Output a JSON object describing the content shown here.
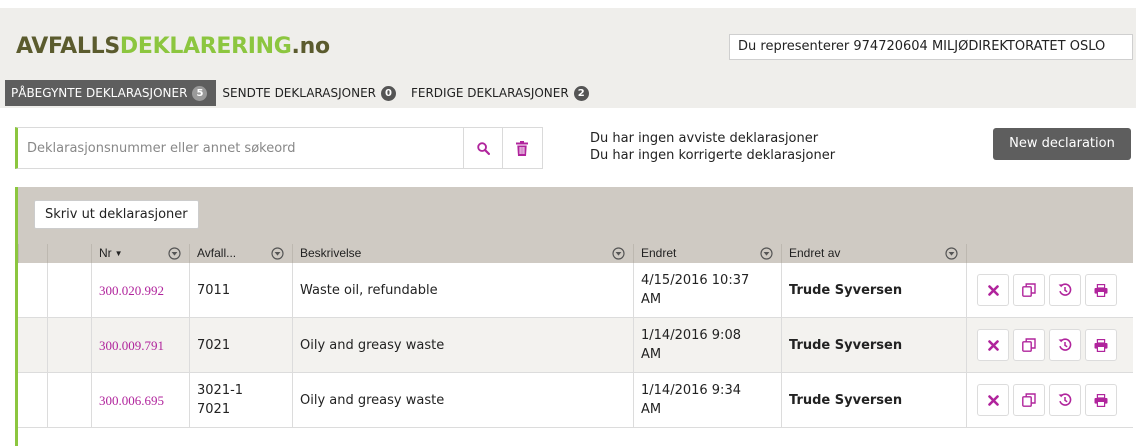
{
  "header": {
    "logo": {
      "part1": "AVFALLS",
      "part2": "DEKLARERING",
      "part3": ".no"
    },
    "representing": "Du representerer 974720604 MILJØDIREKTORATET OSLO"
  },
  "tabs": [
    {
      "label": "PÅBEGYNTE DEKLARASJONER",
      "count": "5"
    },
    {
      "label": "SENDTE DEKLARASJONER",
      "count": "0"
    },
    {
      "label": "FERDIGE DEKLARASJONER",
      "count": "2"
    }
  ],
  "search": {
    "placeholder": "Deklarasjonsnummer eller annet søkeord"
  },
  "info": {
    "line1": "Du har ingen avviste deklarasjoner",
    "line2": "Du har ingen korrigerte deklarasjoner"
  },
  "new_button": "New declaration",
  "print_button": "Skriv ut deklarasjoner",
  "table": {
    "columns": {
      "nr": "Nr",
      "avfall": "Avfall...",
      "beskrivelse": "Beskrivelse",
      "endret": "Endret",
      "endret_av": "Endret av"
    },
    "rows": [
      {
        "nr": "300.020.992",
        "avfall1": "7011",
        "avfall2": "",
        "beskrivelse": "Waste oil, refundable",
        "endret1": "4/15/2016 10:37",
        "endret2": "AM",
        "endret_av": "Trude Syversen"
      },
      {
        "nr": "300.009.791",
        "avfall1": "7021",
        "avfall2": "",
        "beskrivelse": "Oily and greasy waste",
        "endret1": "1/14/2016 9:08",
        "endret2": "AM",
        "endret_av": "Trude Syversen"
      },
      {
        "nr": "300.006.695",
        "avfall1": "3021-1",
        "avfall2": "7021",
        "beskrivelse": "Oily and greasy waste",
        "endret1": "1/14/2016 9:34",
        "endret2": "AM",
        "endret_av": "Trude Syversen"
      }
    ]
  },
  "icons": {
    "search": "search-icon",
    "trash": "trash-icon",
    "filter": "filter-icon",
    "delete": "close-icon",
    "copy": "copy-icon",
    "history": "history-icon",
    "print": "print-icon"
  },
  "colors": {
    "brand_dark": "#5b5b2e",
    "brand_green": "#8cc63f",
    "accent_magenta": "#b0249c",
    "button_dark": "#5e5e5e",
    "panel_beige": "#cfcac3"
  }
}
